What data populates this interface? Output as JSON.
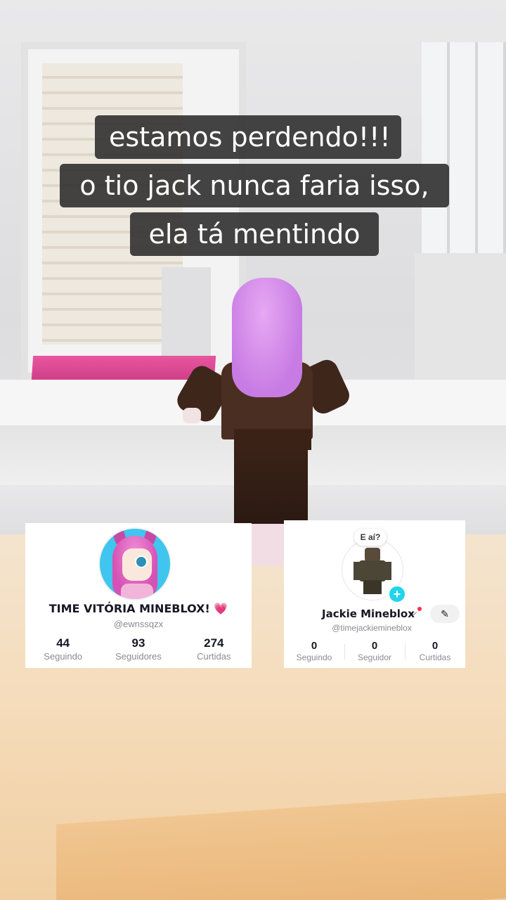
{
  "caption": {
    "lines": [
      "estamos perdendo!!!",
      "o tio jack nunca faria isso,",
      "ela tá mentindo"
    ]
  },
  "profile_left": {
    "name": "TIME VITÓRIA MINEBLOX!",
    "emoji": "💗",
    "handle": "@ewnssqzx",
    "stats": [
      {
        "value": "44",
        "label": "Seguindo"
      },
      {
        "value": "93",
        "label": "Seguidores"
      },
      {
        "value": "274",
        "label": "Curtidas"
      }
    ]
  },
  "profile_right": {
    "bubble": "E aí?",
    "name": "Jackie Mineblox",
    "handle": "@timejackiemineblox",
    "stats": [
      {
        "value": "0",
        "label": "Seguindo"
      },
      {
        "value": "0",
        "label": "Seguidor"
      },
      {
        "value": "0",
        "label": "Curtidas"
      }
    ]
  },
  "icons": {
    "add": "plus-icon",
    "edit": "pencil-icon",
    "dropdown": "chevron-down-icon"
  },
  "colors": {
    "caption_bg": "#303030",
    "accent_teal": "#20d5ec",
    "accent_red": "#fe2c55",
    "heart_pink": "#e23b7a"
  }
}
